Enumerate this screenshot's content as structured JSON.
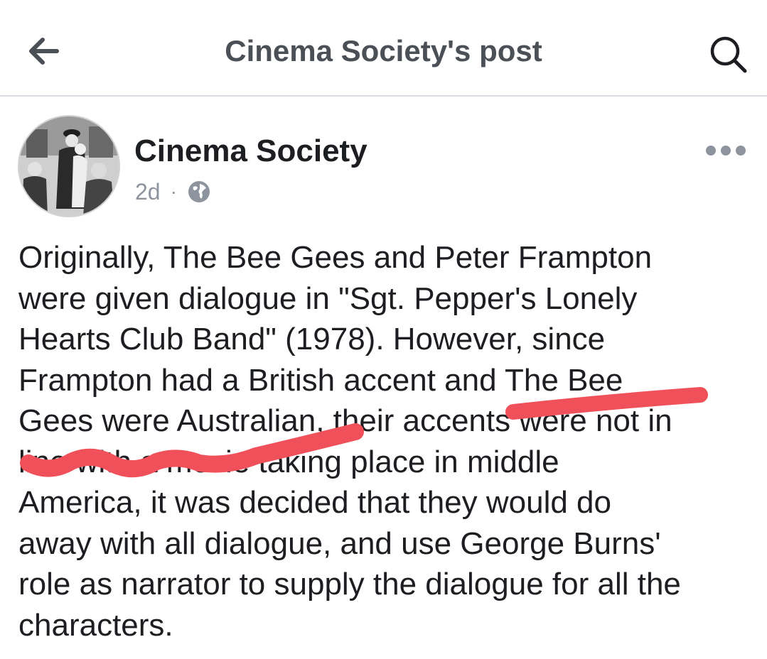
{
  "topbar": {
    "title": "Cinema Society's post",
    "back_icon": "back-arrow-icon",
    "search_icon": "search-icon"
  },
  "post": {
    "author": "Cinema Society",
    "timestamp": "2d",
    "separator": "·",
    "audience_icon": "globe-icon",
    "more_icon": "more-options-icon",
    "text": "Originally, The Bee Gees and Peter Frampton\nwere given dialogue in \"Sgt. Pepper's Lonely\nHearts Club Band\" (1978). However, since\nFrampton had a British accent and The Bee\nGees were Australian, their accents were not in\nline with a movie taking place in middle\nAmerica, it was decided that they would do\naway with all dialogue, and use George Burns'\nrole as narrator to supply the dialogue for all the\ncharacters."
  },
  "colors": {
    "title_gray": "#4b4f56",
    "meta_gray": "#8d949e",
    "text_black": "#1c1e21",
    "divider": "#dadde1",
    "scribble_red": "#f0505a"
  }
}
